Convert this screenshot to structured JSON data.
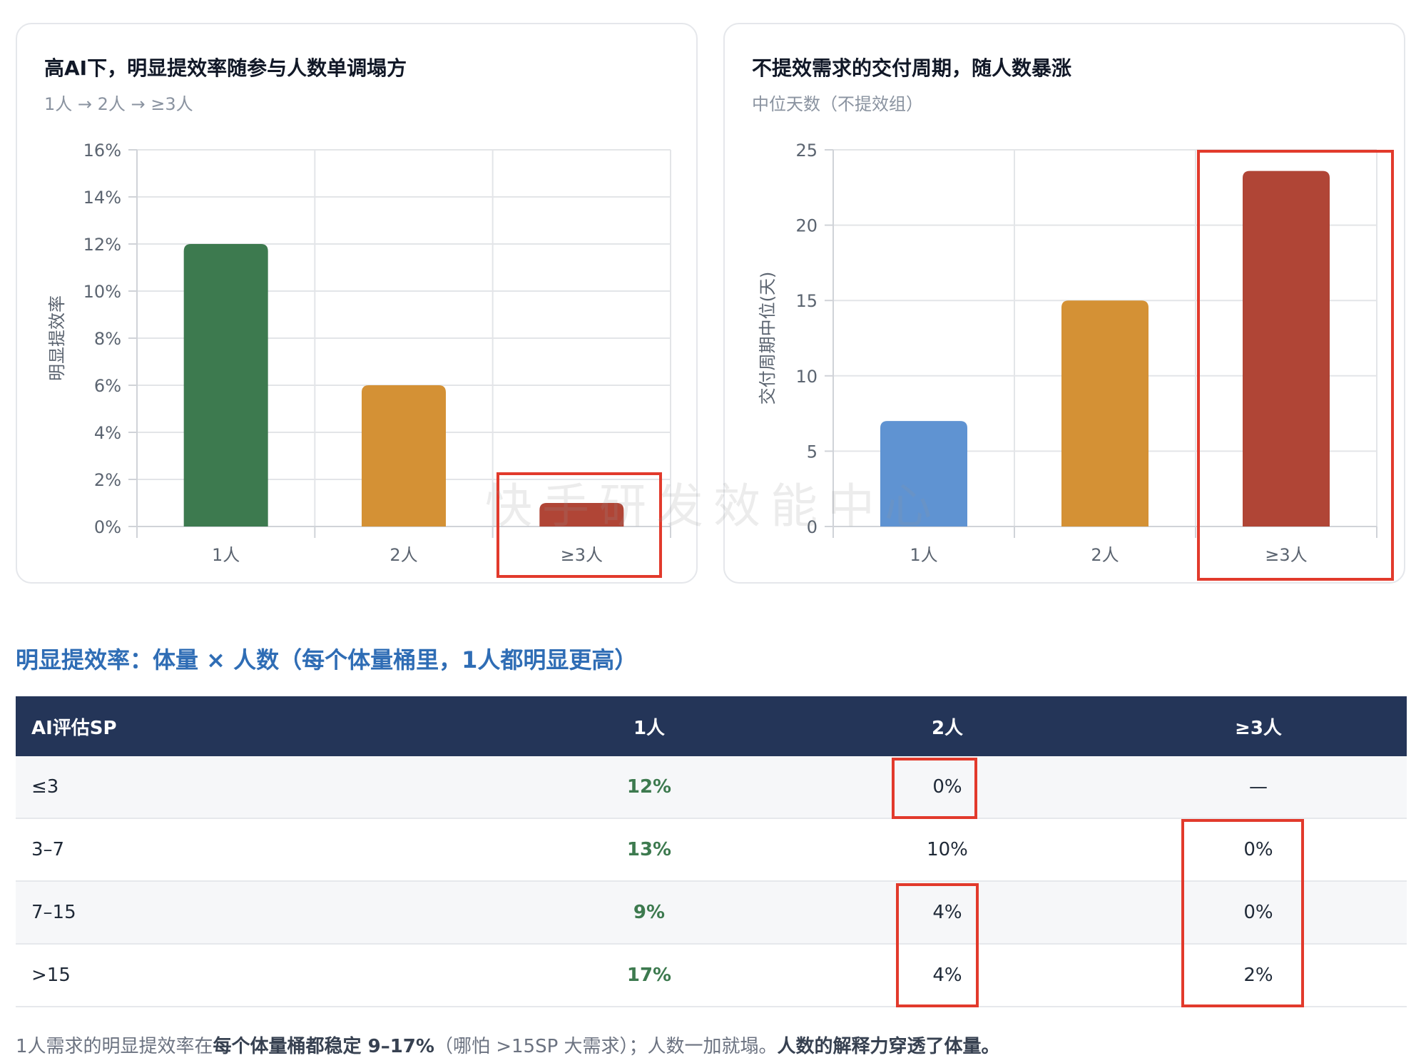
{
  "chart_data": [
    {
      "type": "bar",
      "title": "高AI下，明显提效率随参与人数单调塌方",
      "subtitle": "1人 → 2人 → ≥3人",
      "categories": [
        "1人",
        "2人",
        "≥3人"
      ],
      "values": [
        12,
        6,
        1
      ],
      "colors": [
        "#3d7a4f",
        "#d49135",
        "#b04536"
      ],
      "ylabel": "明显提效率",
      "ylim": [
        0,
        16
      ],
      "yticks": [
        0,
        2,
        4,
        6,
        8,
        10,
        12,
        14,
        16
      ],
      "ytick_labels": [
        "0%",
        "2%",
        "4%",
        "6%",
        "8%",
        "10%",
        "12%",
        "14%",
        "16%"
      ],
      "grid": true,
      "highlight_index": 2
    },
    {
      "type": "bar",
      "title": "不提效需求的交付周期，随人数暴涨",
      "subtitle": "中位天数（不提效组）",
      "categories": [
        "1人",
        "2人",
        "≥3人"
      ],
      "values": [
        7,
        15,
        23.6
      ],
      "colors": [
        "#5f93d2",
        "#d49135",
        "#b04536"
      ],
      "ylabel": "交付周期中位(天)",
      "ylim": [
        0,
        25
      ],
      "yticks": [
        0,
        5,
        10,
        15,
        20,
        25
      ],
      "ytick_labels": [
        "0",
        "5",
        "10",
        "15",
        "20",
        "25"
      ],
      "grid": true,
      "highlight_index": 2
    }
  ],
  "table": {
    "heading": "明显提效率：体量 × 人数（每个体量桶里，1人都明显更高）",
    "columns": [
      "AI评估SP",
      "1人",
      "2人",
      "≥3人"
    ],
    "rows": [
      [
        "≤3",
        "12%",
        "0%",
        "—"
      ],
      [
        "3–7",
        "13%",
        "10%",
        "0%"
      ],
      [
        "7–15",
        "9%",
        "4%",
        "0%"
      ],
      [
        ">15",
        "17%",
        "4%",
        "2%"
      ]
    ],
    "highlight_color": "#e23a2c"
  },
  "footnote": {
    "part1": "1人需求的明显提效率在",
    "part2": "每个体量桶都稳定 9–17%",
    "part3": "（哪怕 >15SP 大需求）；人数一加就塌。",
    "part4": "人数的解释力穿透了体量。"
  },
  "watermark": "快手研发效能中心"
}
